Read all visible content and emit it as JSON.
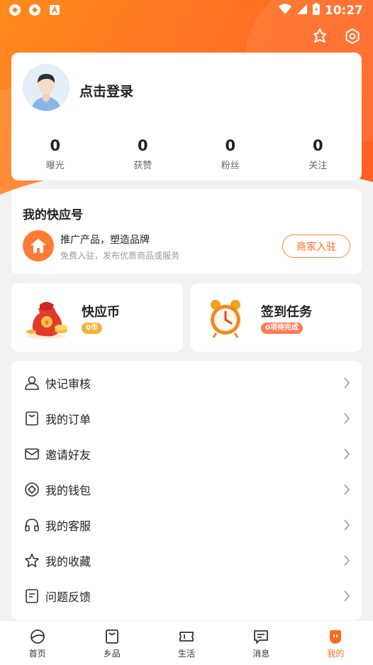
{
  "status_bar": {
    "time": "10:27",
    "icons": [
      "app-icon-1",
      "app-icon-2",
      "a-icon",
      "wifi-icon",
      "signal-icon",
      "battery-charging-icon"
    ]
  },
  "top_actions": {
    "icons": [
      "link-icon",
      "settings-icon"
    ]
  },
  "profile": {
    "login_text": "点击登录",
    "stats": [
      {
        "value": "0",
        "label": "曝光"
      },
      {
        "value": "0",
        "label": "获赞"
      },
      {
        "value": "0",
        "label": "粉丝"
      },
      {
        "value": "0",
        "label": "关注"
      }
    ]
  },
  "kuaiying": {
    "title": "我的快应号",
    "promo_title": "推广产品，塑造品牌",
    "promo_subtitle": "免费入驻，发布优质商品或服务",
    "merchant_button": "商家入驻"
  },
  "features": {
    "coin": {
      "title": "快应币",
      "badge": "0币"
    },
    "task": {
      "title": "签到任务",
      "badge": "0项待完成"
    }
  },
  "menu": [
    {
      "label": "快记审核",
      "icon": "person-review-icon"
    },
    {
      "label": "我的订单",
      "icon": "order-bag-icon"
    },
    {
      "label": "邀请好友",
      "icon": "envelope-icon"
    },
    {
      "label": "我的钱包",
      "icon": "wallet-coin-icon"
    },
    {
      "label": "我的客服",
      "icon": "headset-icon"
    },
    {
      "label": "我的收藏",
      "icon": "star-icon"
    },
    {
      "label": "问题反馈",
      "icon": "feedback-icon"
    }
  ],
  "tabbar": [
    {
      "label": "首页",
      "icon": "home-planet-icon",
      "active": false
    },
    {
      "label": "乡品",
      "icon": "bag-icon",
      "active": false
    },
    {
      "label": "生活",
      "icon": "ticket-icon",
      "active": false
    },
    {
      "label": "消息",
      "icon": "message-icon",
      "active": false
    },
    {
      "label": "我的",
      "icon": "me-icon",
      "active": true
    }
  ],
  "colors": {
    "accent": "#ff6a22",
    "hero_start": "#ff8a1c",
    "hero_end": "#ff5d22",
    "coin_badge": "#f6b13a",
    "task_badge": "#ff7c55"
  }
}
